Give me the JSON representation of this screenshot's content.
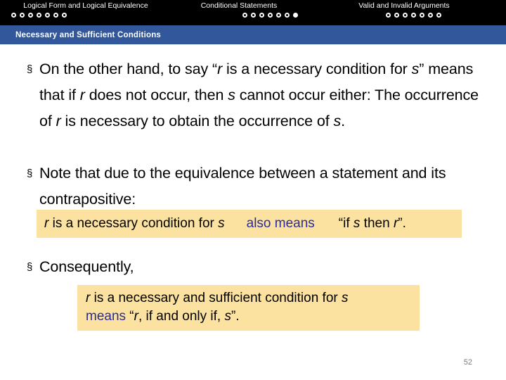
{
  "topnav": {
    "sections": [
      {
        "label": "Logical Form and Logical Equivalence",
        "dots_total": 7,
        "dots_filled_index": -1
      },
      {
        "label": "Conditional Statements",
        "dots_total": 7,
        "dots_filled_index": 6
      },
      {
        "label": "Valid and Invalid Arguments",
        "dots_total": 7,
        "dots_filled_index": -1
      }
    ]
  },
  "titlebar": {
    "title": "Necessary and Sufficient Conditions",
    "color": "#33579B"
  },
  "content": {
    "bullet_mark": "§",
    "bullets": [
      {
        "id": "bullet-1",
        "parts": [
          {
            "text": "On the other hand, to say “",
            "style": "normal"
          },
          {
            "text": "r",
            "style": "italic"
          },
          {
            "text": " is a necessary condition for ",
            "style": "normal"
          },
          {
            "text": "s",
            "style": "italic"
          },
          {
            "text": "” means that if ",
            "style": "normal"
          },
          {
            "text": "r",
            "style": "italic"
          },
          {
            "text": " does not occur, then ",
            "style": "normal"
          },
          {
            "text": "s",
            "style": "italic"
          },
          {
            "text": " cannot occur either: The occurrence of ",
            "style": "normal"
          },
          {
            "text": "r",
            "style": "italic"
          },
          {
            "text": " is necessary to obtain the occurrence of ",
            "style": "normal"
          },
          {
            "text": "s",
            "style": "italic"
          },
          {
            "text": ".",
            "style": "normal"
          }
        ]
      },
      {
        "id": "bullet-2",
        "parts": [
          {
            "text": "Note that due to the equivalence between a statement and its contrapositive:",
            "style": "normal"
          }
        ]
      },
      {
        "id": "bullet-3",
        "parts": [
          {
            "text": "Consequently,",
            "style": "normal"
          }
        ]
      }
    ]
  },
  "highlight_box_1": {
    "background": "#FBE2A0",
    "segment_a": [
      {
        "text": "r",
        "style": "italic"
      },
      {
        "text": " is a necessary condition for ",
        "style": "normal"
      },
      {
        "text": "s",
        "style": "italic"
      }
    ],
    "segment_b": [
      {
        "text": "also means",
        "style": "normal"
      }
    ],
    "segment_b_color": "#2B2B9C",
    "segment_c": [
      {
        "text": "“if ",
        "style": "normal"
      },
      {
        "text": "s",
        "style": "italic"
      },
      {
        "text": " then ",
        "style": "normal"
      },
      {
        "text": "r",
        "style": "italic"
      },
      {
        "text": "”.",
        "style": "normal"
      }
    ]
  },
  "highlight_box_2": {
    "background": "#FBE2A0",
    "line_1": [
      {
        "text": "r",
        "style": "italic"
      },
      {
        "text": " is a necessary and sufficient condition for ",
        "style": "normal"
      },
      {
        "text": "s",
        "style": "italic"
      }
    ],
    "line_2": [
      {
        "text": "means",
        "style": "normal",
        "color": "#2B2B9C"
      },
      {
        "text": " “",
        "style": "normal"
      },
      {
        "text": "r",
        "style": "italic"
      },
      {
        "text": ", if and only if, ",
        "style": "normal"
      },
      {
        "text": "s",
        "style": "italic"
      },
      {
        "text": "”.",
        "style": "normal"
      }
    ]
  },
  "footer": {
    "page_number": "52"
  }
}
